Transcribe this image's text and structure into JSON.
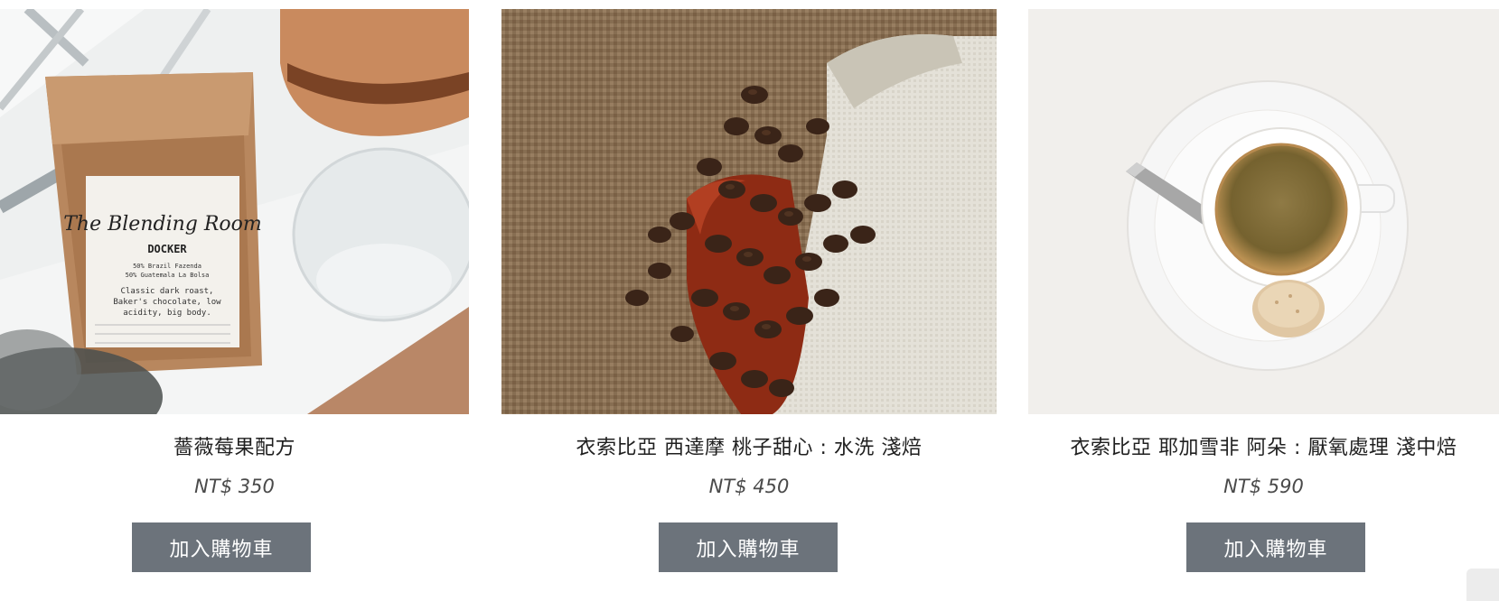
{
  "products": [
    {
      "image": "coffee-bag-with-pour-over",
      "name": "薔薇莓果配方",
      "price": "NT$ 350",
      "button_label": "加入購物車",
      "bag_label": {
        "brand": "The Blending Room",
        "product": "DOCKER",
        "blend_line_1": "50% Brazil Fazenda",
        "blend_line_2": "50% Guatemala La Bolsa",
        "desc_line_1": "Classic dark roast,",
        "desc_line_2": "Baker's chocolate, low",
        "desc_line_3": "acidity, big body."
      }
    },
    {
      "image": "coffee-beans-on-burlap",
      "name": "衣索比亞 西達摩 桃子甜心 : 水洗 淺焙",
      "price": "NT$ 450",
      "button_label": "加入購物車"
    },
    {
      "image": "espresso-cup-on-saucer",
      "name": "衣索比亞 耶加雪非 阿朵 : 厭氧處理 淺中焙",
      "price": "NT$ 590",
      "button_label": "加入購物車"
    }
  ],
  "colors": {
    "button_bg": "#6c737b",
    "button_text": "#ffffff",
    "title_text": "#1f1f1f",
    "price_text": "#4a4a4a"
  }
}
